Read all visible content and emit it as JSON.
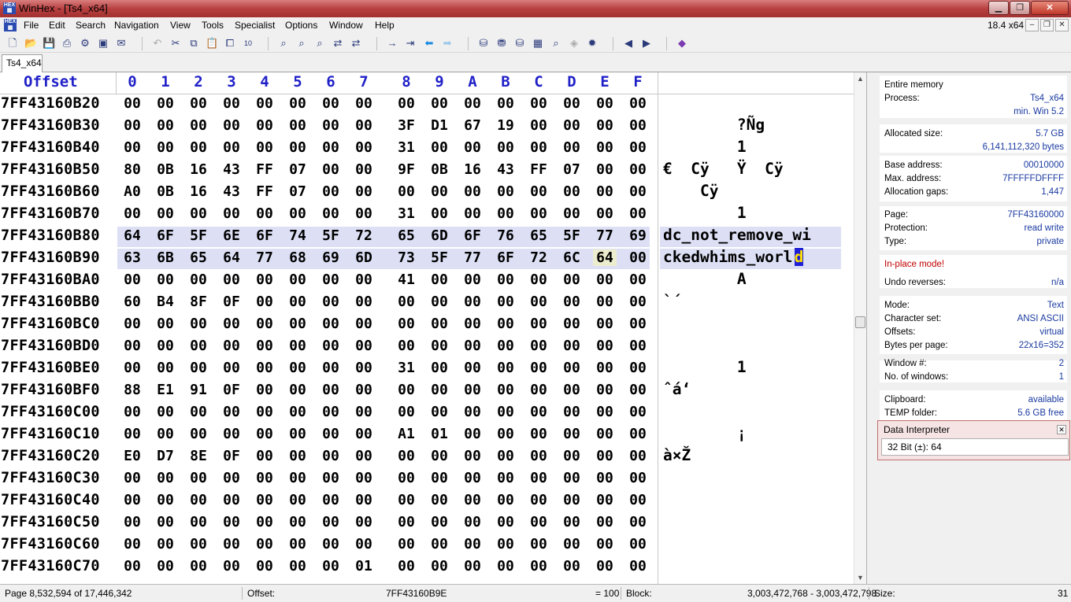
{
  "window": {
    "title": "WinHex - [Ts4_x64]"
  },
  "menu": [
    {
      "label": "File"
    },
    {
      "label": "Edit"
    },
    {
      "label": "Search"
    },
    {
      "label": "Navigation"
    },
    {
      "label": "View"
    },
    {
      "label": "Tools"
    },
    {
      "label": "Specialist"
    },
    {
      "label": "Options"
    },
    {
      "label": "Window"
    },
    {
      "label": "Help"
    }
  ],
  "mdi_size": "18.4 x64",
  "tabs": [
    {
      "label": "Ts4_x64"
    }
  ],
  "editor": {
    "offset_header": "Offset",
    "columns": [
      "0",
      "1",
      "2",
      "3",
      "4",
      "5",
      "6",
      "7",
      "8",
      "9",
      "A",
      "B",
      "C",
      "D",
      "E",
      "F"
    ],
    "rows": [
      {
        "offset": "7FF43160B20",
        "bytes": [
          "00",
          "00",
          "00",
          "00",
          "00",
          "00",
          "00",
          "00",
          "00",
          "00",
          "00",
          "00",
          "00",
          "00",
          "00",
          "00"
        ],
        "text": ""
      },
      {
        "offset": "7FF43160B30",
        "bytes": [
          "00",
          "00",
          "00",
          "00",
          "00",
          "00",
          "00",
          "00",
          "3F",
          "D1",
          "67",
          "19",
          "00",
          "00",
          "00",
          "00"
        ],
        "text": "        ?Ñg"
      },
      {
        "offset": "7FF43160B40",
        "bytes": [
          "00",
          "00",
          "00",
          "00",
          "00",
          "00",
          "00",
          "00",
          "31",
          "00",
          "00",
          "00",
          "00",
          "00",
          "00",
          "00"
        ],
        "text": "        1"
      },
      {
        "offset": "7FF43160B50",
        "bytes": [
          "80",
          "0B",
          "16",
          "43",
          "FF",
          "07",
          "00",
          "00",
          "9F",
          "0B",
          "16",
          "43",
          "FF",
          "07",
          "00",
          "00"
        ],
        "text": "€  Cÿ   Ÿ  Cÿ"
      },
      {
        "offset": "7FF43160B60",
        "bytes": [
          "A0",
          "0B",
          "16",
          "43",
          "FF",
          "07",
          "00",
          "00",
          "00",
          "00",
          "00",
          "00",
          "00",
          "00",
          "00",
          "00"
        ],
        "text": "    Cÿ"
      },
      {
        "offset": "7FF43160B70",
        "bytes": [
          "00",
          "00",
          "00",
          "00",
          "00",
          "00",
          "00",
          "00",
          "31",
          "00",
          "00",
          "00",
          "00",
          "00",
          "00",
          "00"
        ],
        "text": "        1"
      },
      {
        "offset": "7FF43160B80",
        "bytes": [
          "64",
          "6F",
          "5F",
          "6E",
          "6F",
          "74",
          "5F",
          "72",
          "65",
          "6D",
          "6F",
          "76",
          "65",
          "5F",
          "77",
          "69"
        ],
        "text": "dc_not_remove_wi"
      },
      {
        "offset": "7FF43160B90",
        "bytes": [
          "63",
          "6B",
          "65",
          "64",
          "77",
          "68",
          "69",
          "6D",
          "73",
          "5F",
          "77",
          "6F",
          "72",
          "6C",
          "64",
          "00"
        ],
        "text": "ckedwhims_worl",
        "cursor_char": "d"
      },
      {
        "offset": "7FF43160BA0",
        "bytes": [
          "00",
          "00",
          "00",
          "00",
          "00",
          "00",
          "00",
          "00",
          "41",
          "00",
          "00",
          "00",
          "00",
          "00",
          "00",
          "00"
        ],
        "text": "        A"
      },
      {
        "offset": "7FF43160BB0",
        "bytes": [
          "60",
          "B4",
          "8F",
          "0F",
          "00",
          "00",
          "00",
          "00",
          "00",
          "00",
          "00",
          "00",
          "00",
          "00",
          "00",
          "00"
        ],
        "text": "`´"
      },
      {
        "offset": "7FF43160BC0",
        "bytes": [
          "00",
          "00",
          "00",
          "00",
          "00",
          "00",
          "00",
          "00",
          "00",
          "00",
          "00",
          "00",
          "00",
          "00",
          "00",
          "00"
        ],
        "text": ""
      },
      {
        "offset": "7FF43160BD0",
        "bytes": [
          "00",
          "00",
          "00",
          "00",
          "00",
          "00",
          "00",
          "00",
          "00",
          "00",
          "00",
          "00",
          "00",
          "00",
          "00",
          "00"
        ],
        "text": ""
      },
      {
        "offset": "7FF43160BE0",
        "bytes": [
          "00",
          "00",
          "00",
          "00",
          "00",
          "00",
          "00",
          "00",
          "31",
          "00",
          "00",
          "00",
          "00",
          "00",
          "00",
          "00"
        ],
        "text": "        1"
      },
      {
        "offset": "7FF43160BF0",
        "bytes": [
          "88",
          "E1",
          "91",
          "0F",
          "00",
          "00",
          "00",
          "00",
          "00",
          "00",
          "00",
          "00",
          "00",
          "00",
          "00",
          "00"
        ],
        "text": "ˆá‘"
      },
      {
        "offset": "7FF43160C00",
        "bytes": [
          "00",
          "00",
          "00",
          "00",
          "00",
          "00",
          "00",
          "00",
          "00",
          "00",
          "00",
          "00",
          "00",
          "00",
          "00",
          "00"
        ],
        "text": ""
      },
      {
        "offset": "7FF43160C10",
        "bytes": [
          "00",
          "00",
          "00",
          "00",
          "00",
          "00",
          "00",
          "00",
          "A1",
          "01",
          "00",
          "00",
          "00",
          "00",
          "00",
          "00"
        ],
        "text": "        ¡"
      },
      {
        "offset": "7FF43160C20",
        "bytes": [
          "E0",
          "D7",
          "8E",
          "0F",
          "00",
          "00",
          "00",
          "00",
          "00",
          "00",
          "00",
          "00",
          "00",
          "00",
          "00",
          "00"
        ],
        "text": "à×Ž"
      },
      {
        "offset": "7FF43160C30",
        "bytes": [
          "00",
          "00",
          "00",
          "00",
          "00",
          "00",
          "00",
          "00",
          "00",
          "00",
          "00",
          "00",
          "00",
          "00",
          "00",
          "00"
        ],
        "text": ""
      },
      {
        "offset": "7FF43160C40",
        "bytes": [
          "00",
          "00",
          "00",
          "00",
          "00",
          "00",
          "00",
          "00",
          "00",
          "00",
          "00",
          "00",
          "00",
          "00",
          "00",
          "00"
        ],
        "text": ""
      },
      {
        "offset": "7FF43160C50",
        "bytes": [
          "00",
          "00",
          "00",
          "00",
          "00",
          "00",
          "00",
          "00",
          "00",
          "00",
          "00",
          "00",
          "00",
          "00",
          "00",
          "00"
        ],
        "text": ""
      },
      {
        "offset": "7FF43160C60",
        "bytes": [
          "00",
          "00",
          "00",
          "00",
          "00",
          "00",
          "00",
          "00",
          "00",
          "00",
          "00",
          "00",
          "00",
          "00",
          "00",
          "00"
        ],
        "text": ""
      },
      {
        "offset": "7FF43160C70",
        "bytes": [
          "00",
          "00",
          "00",
          "00",
          "00",
          "00",
          "00",
          "01",
          "00",
          "00",
          "00",
          "00",
          "00",
          "00",
          "00",
          "00"
        ],
        "text": ""
      }
    ]
  },
  "info_panel": [
    {
      "label": "Entire memory",
      "value": ""
    },
    {
      "label": "Process:",
      "value": "Ts4_x64"
    },
    {
      "label": "",
      "value": "min. Win 5.2"
    },
    {
      "label": "Allocated size:",
      "value": "5.7 GB"
    },
    {
      "label": "",
      "value": "6,141,112,320 bytes"
    },
    {
      "label": "Base address:",
      "value": "00010000"
    },
    {
      "label": "Max. address:",
      "value": "7FFFFFDFFFF"
    },
    {
      "label": "Allocation gaps:",
      "value": "1,447"
    },
    {
      "label": "Page:",
      "value": "7FF43160000"
    },
    {
      "label": "Protection:",
      "value": "read write"
    },
    {
      "label": "Type:",
      "value": "private"
    },
    {
      "label": "In-place mode!",
      "value": ""
    },
    {
      "label": "Undo reverses:",
      "value": "n/a"
    },
    {
      "label": "Mode:",
      "value": "Text"
    },
    {
      "label": "Character set:",
      "value": "ANSI ASCII"
    },
    {
      "label": "Offsets:",
      "value": "virtual"
    },
    {
      "label": "Bytes per page:",
      "value": "22x16=352"
    },
    {
      "label": "Window #:",
      "value": "2"
    },
    {
      "label": "No. of windows:",
      "value": "1"
    },
    {
      "label": "Clipboard:",
      "value": "available"
    },
    {
      "label": "TEMP folder:",
      "value": "5.6 GB free"
    }
  ],
  "data_interpreter": {
    "title": "Data Interpreter",
    "field": "32 Bit (±):  64"
  },
  "status": {
    "page": "Page 8,532,594 of 17,446,342",
    "offset_label": "Offset:",
    "offset_value": "7FF43160B9E",
    "equals": "= 100",
    "block_label": "Block:",
    "block_value": "3,003,472,768 - 3,003,472,798",
    "size_label": "Size:",
    "size_value": "31"
  },
  "colors": {
    "header_blue": "#2020c8",
    "selection": "#dde0f5",
    "cursor": "#1f1fd6",
    "info_value": "#1a3aa0",
    "warning": "#c00000"
  }
}
